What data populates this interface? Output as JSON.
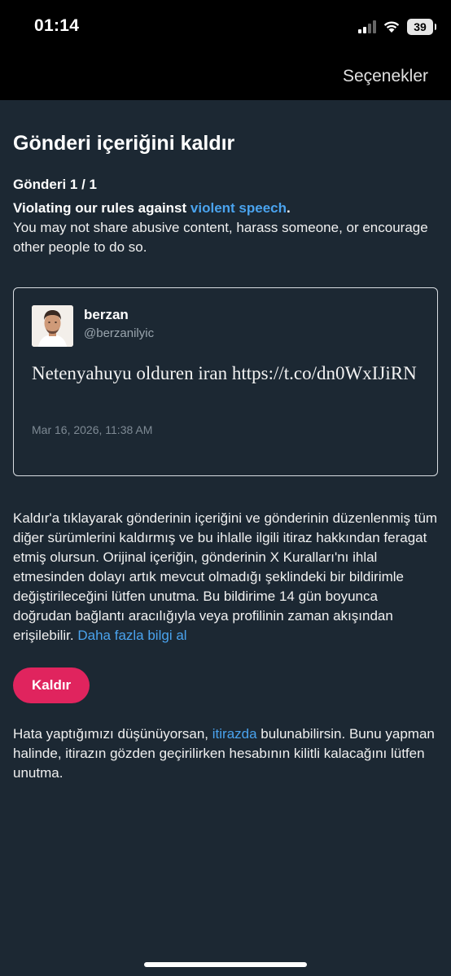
{
  "status": {
    "time": "01:14",
    "battery": "39"
  },
  "nav": {
    "options_label": "Seçenekler"
  },
  "page": {
    "title": "Gönderi içeriğini kaldır",
    "post_count": "Gönderi 1 / 1",
    "violation_prefix": "Violating our rules against ",
    "violation_link": "violent speech",
    "violation_suffix": ".",
    "violation_desc": "You may not share abusive content, harass someone, or encourage other people to do so."
  },
  "tweet": {
    "author_name": "berzan",
    "author_handle": "@berzanilyic",
    "text": "Netenyahuyu olduren iran https://t.co/dn0WxIJiRN",
    "date": "Mar 16, 2026, 11:38 AM"
  },
  "notice": {
    "text": "Kaldır'a tıklayarak gönderinin içeriğini ve gönderinin düzenlenmiş tüm diğer sürümlerini kaldırmış ve bu ihlalle ilgili itiraz hakkından feragat etmiş olursun. Orijinal içeriğin, gönderinin X Kuralları'nı ihlal etmesinden dolayı artık mevcut olmadığı şeklindeki bir bildirimle değiştirileceğini lütfen unutma. Bu bildirime 14 gün boyunca doğrudan bağlantı aracılığıyla veya profilinin zaman akışından erişilebilir. ",
    "link": "Daha fazla bilgi al"
  },
  "remove_button": {
    "label": "Kaldır"
  },
  "appeal": {
    "prefix": "Hata yaptığımızı düşünüyorsan, ",
    "link": "itirazda",
    "suffix": " bulunabilirsin. Bunu yapman halinde, itirazın gözden geçirilirken hesabının kilitli kalacağını lütfen unutma."
  },
  "colors": {
    "accent": "#4aa3ee",
    "danger": "#e0245e",
    "background": "#1c2833"
  },
  "icons": [
    "signal-icon",
    "wifi-icon",
    "battery-icon"
  ]
}
